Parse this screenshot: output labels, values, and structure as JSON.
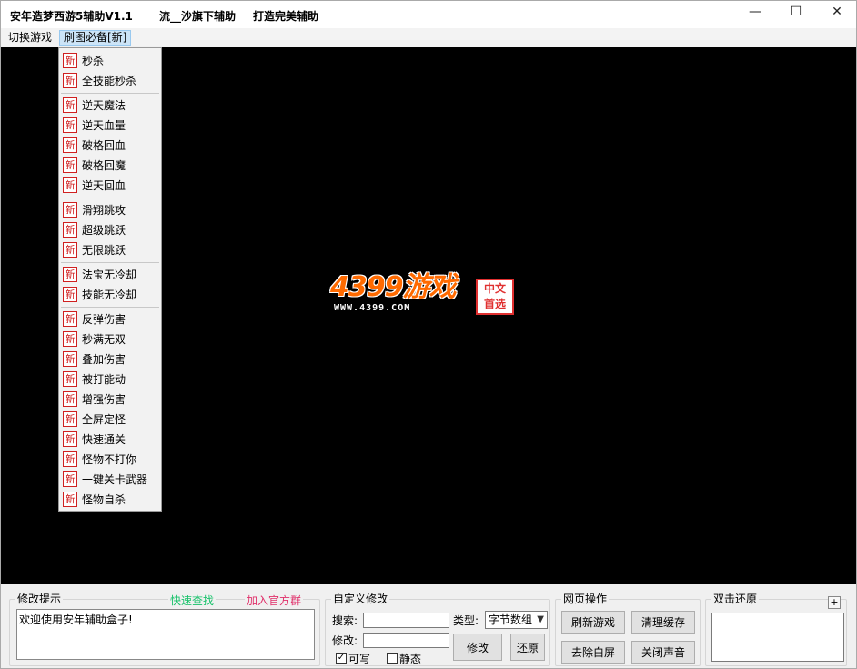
{
  "titlebar": {
    "app_title": "安年造梦西游5辅助V1.1",
    "tagline_1": "流__沙旗下辅助",
    "tagline_2": "打造完美辅助",
    "minimize": "—",
    "maximize": "☐",
    "close": "✕"
  },
  "menubar": {
    "items": [
      {
        "label": "切换游戏"
      },
      {
        "label": "刷图必备[新]"
      }
    ]
  },
  "game": {
    "logo_text": "4399游戏",
    "logo_url": "WWW.4399.COM",
    "logo_seal": "中文\n首选"
  },
  "dropdown": {
    "badge": "新",
    "groups": [
      [
        "秒杀",
        "全技能秒杀"
      ],
      [
        "逆天魔法",
        "逆天血量",
        "破格回血",
        "破格回魔",
        "逆天回血"
      ],
      [
        "滑翔跳攻",
        "超级跳跃",
        "无限跳跃"
      ],
      [
        "法宝无冷却",
        "技能无冷却"
      ],
      [
        "反弹伤害",
        "秒满无双",
        "叠加伤害",
        "被打能动",
        "增强伤害",
        "全屏定怪",
        "快速通关",
        "怪物不打你",
        "一键关卡武器",
        "怪物自杀"
      ]
    ]
  },
  "panel_hint": {
    "title": "修改提示",
    "quick_find": "快速查找",
    "join_group": "加入官方群",
    "message": "欢迎使用安年辅助盒子!",
    "quick_find_color": "#19c26b",
    "join_group_color": "#e0306a"
  },
  "panel_custom": {
    "title": "自定义修改",
    "search_label": "搜索:",
    "search_value": "",
    "type_label": "类型:",
    "type_selected": "字节数组",
    "modify_label": "修改:",
    "modify_value": "",
    "modify_button": "修改",
    "restore_button": "还原",
    "writable_label": "可写",
    "writable_checked": "✓",
    "static_label": "静态"
  },
  "panel_web": {
    "title": "网页操作",
    "refresh_game": "刷新游戏",
    "clear_cache": "清理缓存",
    "remove_white": "去除白屏",
    "mute": "关闭声音"
  },
  "panel_restore": {
    "title": "双击还原",
    "add": "+"
  }
}
